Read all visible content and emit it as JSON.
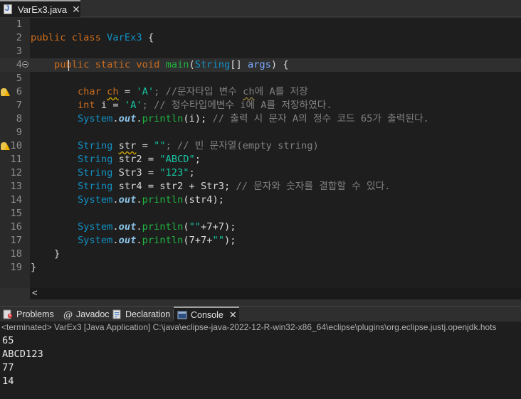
{
  "editor": {
    "tab": {
      "label": "VarEx3.java",
      "close": "✕"
    },
    "lines": [
      {
        "num": "1",
        "tokens": []
      },
      {
        "num": "2",
        "tokens": [
          {
            "t": "public ",
            "c": "kw"
          },
          {
            "t": "class ",
            "c": "kw"
          },
          {
            "t": "VarEx3",
            "c": "type"
          },
          {
            "t": " {",
            "c": ""
          }
        ]
      },
      {
        "num": "3",
        "tokens": []
      },
      {
        "num": "4",
        "current": true,
        "fold": true,
        "tokens": [
          {
            "t": "    ",
            "c": ""
          },
          {
            "t": "public ",
            "c": "kw"
          },
          {
            "t": "static ",
            "c": "kw"
          },
          {
            "t": "void ",
            "c": "kw"
          },
          {
            "t": "main",
            "c": "mth"
          },
          {
            "t": "(",
            "c": ""
          },
          {
            "t": "String",
            "c": "type"
          },
          {
            "t": "[] ",
            "c": ""
          },
          {
            "t": "args",
            "c": "param"
          },
          {
            "t": ") {",
            "c": ""
          }
        ]
      },
      {
        "num": "5",
        "tokens": []
      },
      {
        "num": "6",
        "warning": true,
        "tokens": [
          {
            "t": "        ",
            "c": ""
          },
          {
            "t": "char ",
            "c": "kw"
          },
          {
            "t": "ch",
            "c": "kw warnvar"
          },
          {
            "t": " = ",
            "c": ""
          },
          {
            "t": "'A'",
            "c": "str"
          },
          {
            "t": "; //문자타입 변수 ",
            "c": "cmt"
          },
          {
            "t": "ch",
            "c": "cmt warnsq"
          },
          {
            "t": "에 A를 저장",
            "c": "cmt"
          }
        ]
      },
      {
        "num": "7",
        "tokens": [
          {
            "t": "        ",
            "c": ""
          },
          {
            "t": "int ",
            "c": "kw"
          },
          {
            "t": "i",
            "c": ""
          },
          {
            "t": " = ",
            "c": ""
          },
          {
            "t": "'A'",
            "c": "str"
          },
          {
            "t": "; // 정수타입에변수 i에 A를 저장하였다.",
            "c": "cmt"
          }
        ]
      },
      {
        "num": "8",
        "tokens": [
          {
            "t": "        ",
            "c": ""
          },
          {
            "t": "System",
            "c": "type"
          },
          {
            "t": ".",
            "c": ""
          },
          {
            "t": "out",
            "c": "fld"
          },
          {
            "t": ".",
            "c": ""
          },
          {
            "t": "println",
            "c": "mth"
          },
          {
            "t": "(i); ",
            "c": ""
          },
          {
            "t": "// 출력 시 문자 A의 정수 코드 65가 출력된다.",
            "c": "cmt"
          }
        ]
      },
      {
        "num": "9",
        "tokens": []
      },
      {
        "num": "10",
        "warning": true,
        "tokens": [
          {
            "t": "        ",
            "c": ""
          },
          {
            "t": "String ",
            "c": "type"
          },
          {
            "t": "str",
            "c": "warnvar"
          },
          {
            "t": " = ",
            "c": ""
          },
          {
            "t": "\"\"",
            "c": "str"
          },
          {
            "t": "; // 빈 문자열(empty string)",
            "c": "cmt"
          }
        ]
      },
      {
        "num": "11",
        "tokens": [
          {
            "t": "        ",
            "c": ""
          },
          {
            "t": "String ",
            "c": "type"
          },
          {
            "t": "str2 = ",
            "c": ""
          },
          {
            "t": "\"ABCD\"",
            "c": "str"
          },
          {
            "t": ";",
            "c": ""
          }
        ]
      },
      {
        "num": "12",
        "tokens": [
          {
            "t": "        ",
            "c": ""
          },
          {
            "t": "String ",
            "c": "type"
          },
          {
            "t": "Str3 = ",
            "c": ""
          },
          {
            "t": "\"123\"",
            "c": "str"
          },
          {
            "t": ";",
            "c": ""
          }
        ]
      },
      {
        "num": "13",
        "tokens": [
          {
            "t": "        ",
            "c": ""
          },
          {
            "t": "String ",
            "c": "type"
          },
          {
            "t": "str4 = str2 + Str3; ",
            "c": ""
          },
          {
            "t": "// 문자와 숫자를 결합할 수 있다.",
            "c": "cmt"
          }
        ]
      },
      {
        "num": "14",
        "tokens": [
          {
            "t": "        ",
            "c": ""
          },
          {
            "t": "System",
            "c": "type"
          },
          {
            "t": ".",
            "c": ""
          },
          {
            "t": "out",
            "c": "fld"
          },
          {
            "t": ".",
            "c": ""
          },
          {
            "t": "println",
            "c": "mth"
          },
          {
            "t": "(str4);",
            "c": ""
          }
        ]
      },
      {
        "num": "15",
        "tokens": []
      },
      {
        "num": "16",
        "tokens": [
          {
            "t": "        ",
            "c": ""
          },
          {
            "t": "System",
            "c": "type"
          },
          {
            "t": ".",
            "c": ""
          },
          {
            "t": "out",
            "c": "fld"
          },
          {
            "t": ".",
            "c": ""
          },
          {
            "t": "println",
            "c": "mth"
          },
          {
            "t": "(",
            "c": ""
          },
          {
            "t": "\"\"",
            "c": "str"
          },
          {
            "t": "+7+7);",
            "c": ""
          }
        ]
      },
      {
        "num": "17",
        "tokens": [
          {
            "t": "        ",
            "c": ""
          },
          {
            "t": "System",
            "c": "type"
          },
          {
            "t": ".",
            "c": ""
          },
          {
            "t": "out",
            "c": "fld"
          },
          {
            "t": ".",
            "c": ""
          },
          {
            "t": "println",
            "c": "mth"
          },
          {
            "t": "(7+7+",
            "c": ""
          },
          {
            "t": "\"\"",
            "c": "str"
          },
          {
            "t": ");",
            "c": ""
          }
        ]
      },
      {
        "num": "18",
        "tokens": [
          {
            "t": "    }",
            "c": ""
          }
        ]
      },
      {
        "num": "19",
        "tokens": [
          {
            "t": "}",
            "c": ""
          }
        ]
      }
    ],
    "scroll_left": "<"
  },
  "panel": {
    "tabs": [
      {
        "label": "Problems",
        "icon": "problems-icon"
      },
      {
        "label": "Javadoc",
        "icon": "javadoc-icon"
      },
      {
        "label": "Declaration",
        "icon": "declaration-icon"
      },
      {
        "label": "Console",
        "icon": "console-icon",
        "active": true,
        "close": "✕"
      }
    ],
    "status": "<terminated> VarEx3 [Java Application] C:\\java\\eclipse-java-2022-12-R-win32-x86_64\\eclipse\\plugins\\org.eclipse.justj.openjdk.hots",
    "output": [
      "65",
      "ABCD123",
      "77",
      "14"
    ]
  },
  "colors": {
    "background": "#1e1e1e",
    "keyword": "#cc6c1d",
    "type": "#1290c3",
    "string": "#17c6a3",
    "comment": "#808080",
    "method": "#1eb540"
  }
}
